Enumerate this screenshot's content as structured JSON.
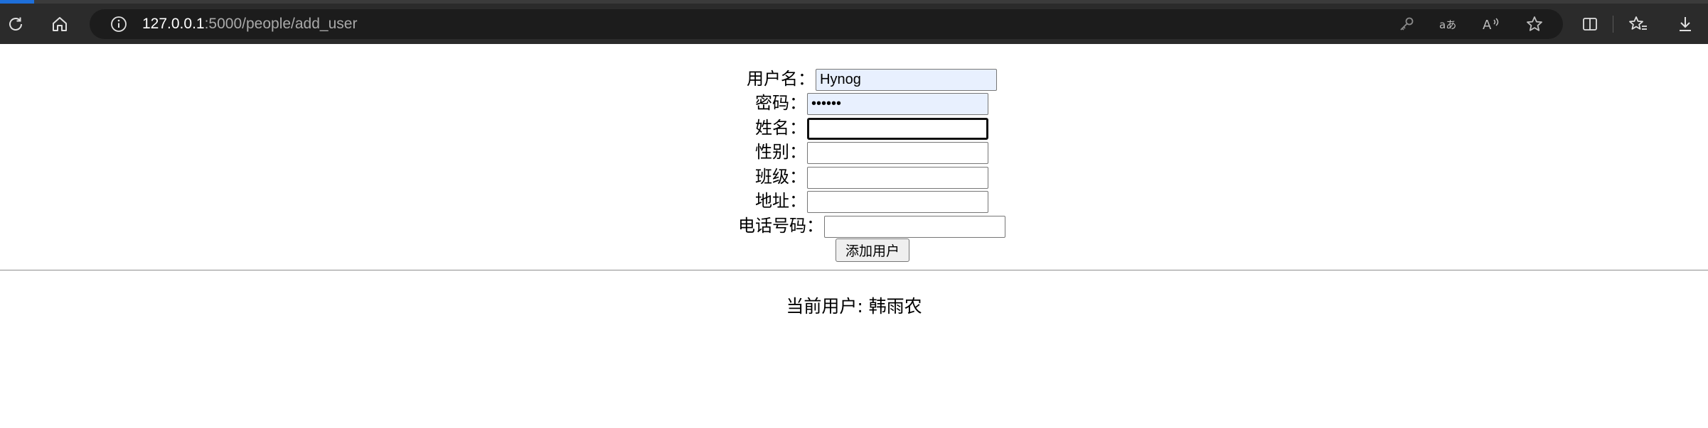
{
  "browser": {
    "url_host": "127.0.0.1",
    "url_path": ":5000/people/add_user",
    "icons": {
      "reload": "reload-icon",
      "home": "home-icon",
      "site_info": "info-icon",
      "password_key": "key-icon",
      "translate": "translate-icon",
      "read_aloud": "read-aloud-icon",
      "favorite": "star-icon",
      "split_screen": "split-screen-icon",
      "favorites": "favorites-icon",
      "downloads": "download-icon"
    }
  },
  "form": {
    "username": {
      "label": "用户名：",
      "value": "Hynog"
    },
    "password": {
      "label": "密码：",
      "value": "••••••"
    },
    "name": {
      "label": "姓名：",
      "value": ""
    },
    "gender": {
      "label": "性别：",
      "value": ""
    },
    "class": {
      "label": "班级：",
      "value": ""
    },
    "address": {
      "label": "地址：",
      "value": ""
    },
    "phone": {
      "label": "电话号码：",
      "value": ""
    },
    "submit_label": "添加用户"
  },
  "footer": {
    "current_user": "当前用户: 韩雨农"
  }
}
